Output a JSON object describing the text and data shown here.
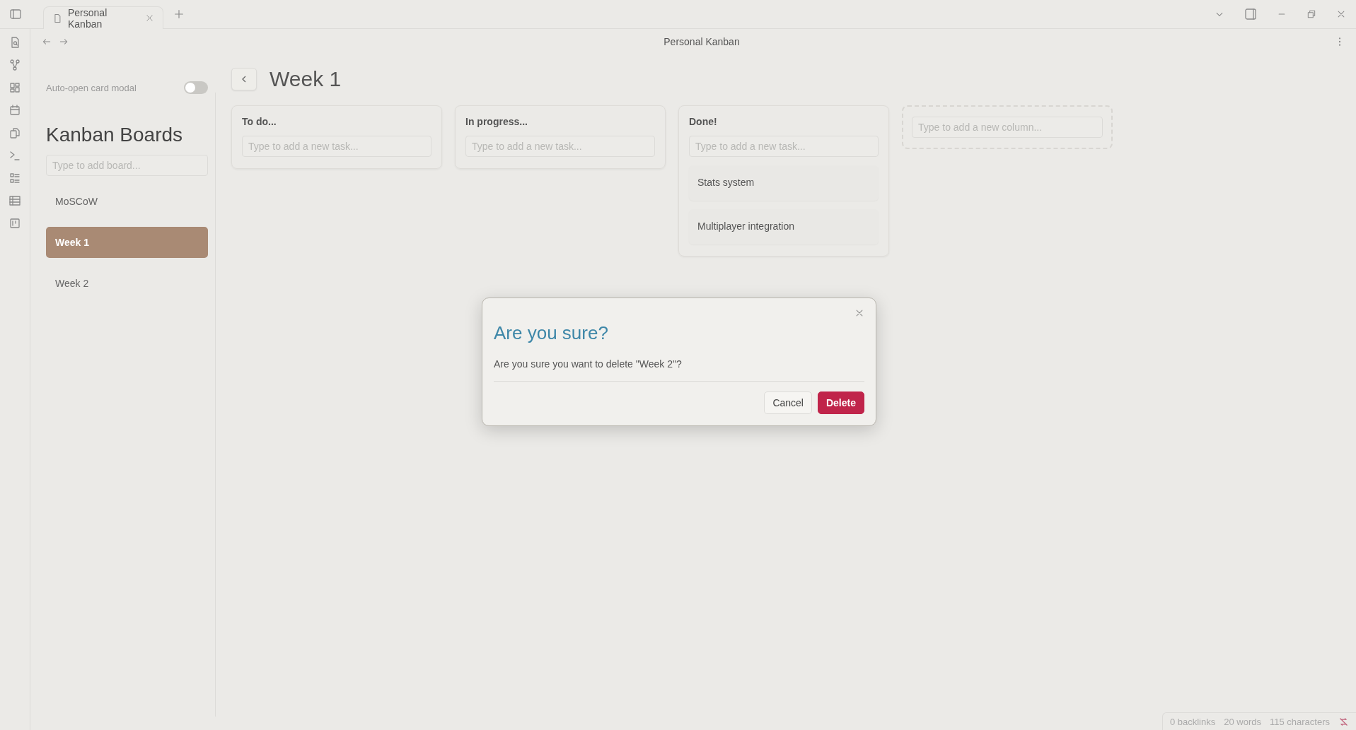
{
  "window": {
    "tab": "Personal Kanban",
    "title": "Personal Kanban"
  },
  "sidebar": {
    "toggle": {
      "label": "Auto-open card modal",
      "on": false
    },
    "heading": "Kanban Boards",
    "search": {
      "placeholder": "Type to add board..."
    },
    "boards": [
      {
        "label": "MoSCoW",
        "selected": false
      },
      {
        "label": "Week 1",
        "selected": true
      },
      {
        "label": "Week 2",
        "selected": false
      }
    ]
  },
  "board": {
    "title": "Week 1",
    "columns": [
      {
        "title": "To do...",
        "placeholder": "Type to add a new task..."
      },
      {
        "title": "In progress...",
        "placeholder": "Type to add a new task..."
      },
      {
        "title": "Done!",
        "placeholder": "Type to add a new task...",
        "cards": [
          "Stats system",
          "Multiplayer integration"
        ]
      }
    ],
    "new_column": {
      "placeholder": "Type to add a new column..."
    }
  },
  "dialog": {
    "title": "Are you sure?",
    "message": "Are you sure you want to delete \"Week 2\"?",
    "buttons": [
      {
        "label": "Cancel",
        "kind": "secondary"
      },
      {
        "label": "Delete",
        "kind": "danger"
      }
    ]
  },
  "status_bar": [
    "0 backlinks",
    "20 words",
    "115 characters"
  ]
}
